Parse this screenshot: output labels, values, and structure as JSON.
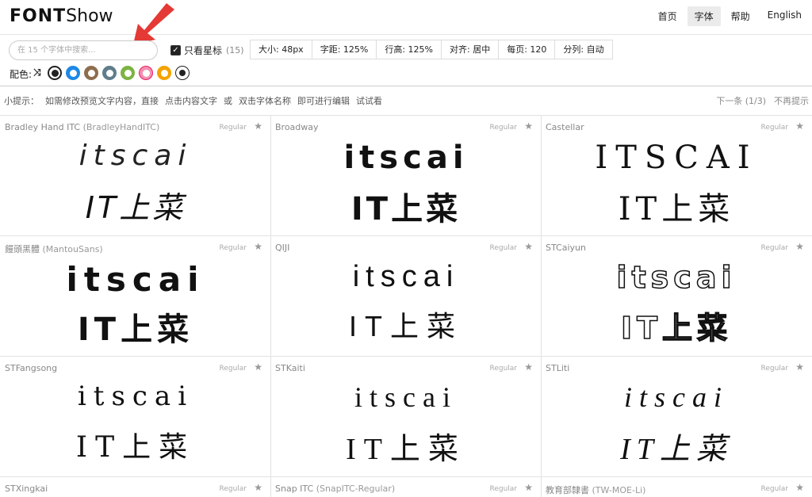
{
  "header": {
    "logo_bold": "FONT",
    "logo_light": "Show",
    "nav": [
      {
        "label": "首页",
        "active": false
      },
      {
        "label": "字体",
        "active": true
      },
      {
        "label": "帮助",
        "active": false
      },
      {
        "label": "English",
        "active": false
      }
    ]
  },
  "toolbar": {
    "search_placeholder": "在 15 个字体中搜索...",
    "star_only_label": "只看星标",
    "star_only_checked": true,
    "star_count": "(15)",
    "settings": [
      "大小: 48px",
      "字距: 125%",
      "行高: 125%",
      "对齐: 居中",
      "每页: 120",
      "分列: 自动"
    ],
    "colors_label": "配色:",
    "shuffle_icon": "shuffle-icon",
    "swatches": [
      {
        "ring": "#222222",
        "dot": "#222222",
        "selected": true
      },
      {
        "ring": "#1e88e5",
        "dot": "#ffffff"
      },
      {
        "ring": "#8d6e4f",
        "dot": "#ffffff"
      },
      {
        "ring": "#607d8b",
        "dot": "#ffffff"
      },
      {
        "ring": "#7cb342",
        "dot": "#ffffff"
      },
      {
        "ring": "#e91e63",
        "dot": "#ffffff"
      },
      {
        "ring": "#f4a300",
        "dot": "#ffffff"
      },
      {
        "ring": "#222222",
        "dot": "#ffffff"
      }
    ]
  },
  "tip": {
    "parts": [
      "小提示：",
      "如需修改预览文字内容，直接",
      "点击内容文字",
      "或",
      "双击字体名称",
      "即可进行编辑",
      "试试看"
    ],
    "next": "下一条 (1/3)",
    "dismiss": "不再提示"
  },
  "preview": {
    "line1": "itscai",
    "line1_upper": "ITSCAI",
    "line2": "IT上菜"
  },
  "fonts": [
    {
      "name": "Bradley Hand ITC",
      "alt": "(BradleyHandITC)",
      "style": "Regular"
    },
    {
      "name": "Broadway",
      "alt": "",
      "style": "Regular"
    },
    {
      "name": "Castellar",
      "alt": "",
      "style": "Regular"
    },
    {
      "name": "饅頭黑體",
      "alt": "(MantouSans)",
      "style": "Regular"
    },
    {
      "name": "QIJI",
      "alt": "",
      "style": "Regular"
    },
    {
      "name": "STCaiyun",
      "alt": "",
      "style": "Regular"
    },
    {
      "name": "STFangsong",
      "alt": "",
      "style": "Regular"
    },
    {
      "name": "STKaiti",
      "alt": "",
      "style": "Regular"
    },
    {
      "name": "STLiti",
      "alt": "",
      "style": "Regular"
    },
    {
      "name": "STXingkai",
      "alt": "",
      "style": "Regular"
    },
    {
      "name": "Snap ITC",
      "alt": "(SnapITC-Regular)",
      "style": "Regular"
    },
    {
      "name": "教育部隸書",
      "alt": "(TW-MOE-Li)",
      "style": "Regular"
    }
  ],
  "annotation_color": "#e53935"
}
